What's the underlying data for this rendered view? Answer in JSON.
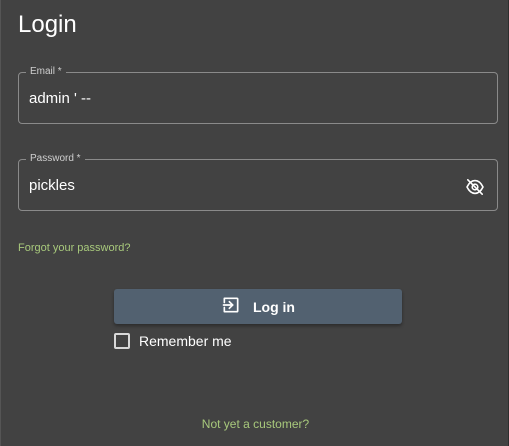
{
  "title": "Login",
  "email": {
    "label": "Email *",
    "value": "admin ' --"
  },
  "password": {
    "label": "Password *",
    "value": "pickles",
    "toggle_icon": "eye-off-icon"
  },
  "forgot_link": "Forgot your password?",
  "login_button": {
    "label": "Log in",
    "icon": "login-icon"
  },
  "remember": {
    "label": "Remember me",
    "checked": false
  },
  "customer_link": "Not yet a customer?",
  "colors": {
    "background": "#424242",
    "accent_link": "#a8c97c",
    "button": "#526170",
    "text": "#ffffff"
  }
}
